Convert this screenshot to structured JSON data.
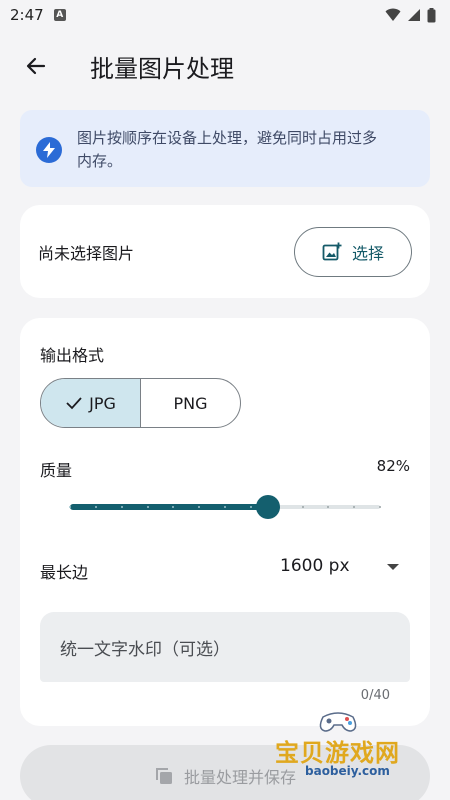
{
  "status_bar": {
    "time": "2:47",
    "indicator": "A"
  },
  "header": {
    "title": "批量图片处理"
  },
  "info_banner": {
    "text_line1": "图片按顺序在设备上处理，避免同时占用过多",
    "text_line2": "内存。"
  },
  "image_select": {
    "status_text": "尚未选择图片",
    "button_label": "选择"
  },
  "output_format": {
    "label": "输出格式",
    "options": [
      "JPG",
      "PNG"
    ],
    "selected": "JPG"
  },
  "quality": {
    "label": "质量",
    "value_text": "82%",
    "value": 0.82
  },
  "max_side": {
    "label": "最长边",
    "value": "1600 px"
  },
  "watermark": {
    "placeholder": "统一文字水印（可选）",
    "counter": "0/40"
  },
  "save_button": {
    "label": "批量处理并保存"
  },
  "overlay_watermark": {
    "name": "宝贝游戏网",
    "url": "baobeiy.com"
  },
  "colors": {
    "accent": "#145f6e",
    "banner_bg": "#e6edfb",
    "bolt": "#2b6bd6",
    "segment_selected": "#cfe6ee"
  }
}
